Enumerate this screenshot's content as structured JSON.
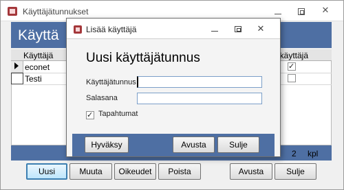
{
  "main_window": {
    "title": "Käyttäjätunnukset",
    "header_title": "Käyttä",
    "columns": {
      "user": "Käyttäjä",
      "admin": "ikäyttäjä"
    },
    "rows": [
      {
        "name": "econet",
        "admin_checked": true,
        "current": true
      },
      {
        "name": "Testi",
        "admin_checked": false,
        "current": false
      }
    ],
    "record_count": "2",
    "record_unit": "kpl",
    "buttons": {
      "new": "Uusi",
      "edit": "Muuta",
      "rights": "Oikeudet",
      "delete": "Poista",
      "help": "Avusta",
      "close": "Sulje"
    },
    "close_glyph": "✕"
  },
  "dialog": {
    "title": "Lisää käyttäjä",
    "heading": "Uusi käyttäjätunnus",
    "fields": {
      "username_label": "Käyttäjätunnus",
      "username_value": "",
      "password_label": "Salasana",
      "password_value": ""
    },
    "checkbox": {
      "label": "Tapahtumat",
      "checked": true
    },
    "buttons": {
      "accept": "Hyväksy",
      "help": "Avusta",
      "close": "Sulje"
    },
    "close_glyph": "✕"
  },
  "colors": {
    "band": "#4e6fa3",
    "app_icon": "#a4373a",
    "default_button_border": "#3c7fb1"
  },
  "icons": [
    "access-form-icon",
    "minimize-icon",
    "maximize-icon",
    "close-icon",
    "record-selector-arrow-icon",
    "check-icon"
  ]
}
